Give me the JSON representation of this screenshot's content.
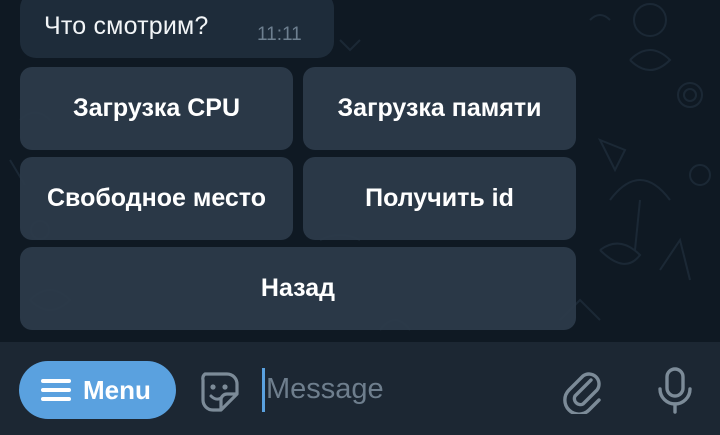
{
  "message": {
    "text": "Что смотрим?",
    "time": "11:11"
  },
  "keyboard": {
    "buttons": [
      "Загрузка CPU",
      "Загрузка памяти",
      "Свободное место",
      "Получить id",
      "Назад"
    ]
  },
  "input_bar": {
    "menu_label": "Menu",
    "placeholder": "Message",
    "icons": [
      "hamburger-icon",
      "sticker-icon",
      "paperclip-icon",
      "microphone-icon"
    ]
  },
  "colors": {
    "background": "#0f1923",
    "bubble": "#1e2c3a",
    "keyboard_button": "#2c3b4a",
    "input_bar": "#1c2733",
    "accent": "#5aa1df"
  }
}
